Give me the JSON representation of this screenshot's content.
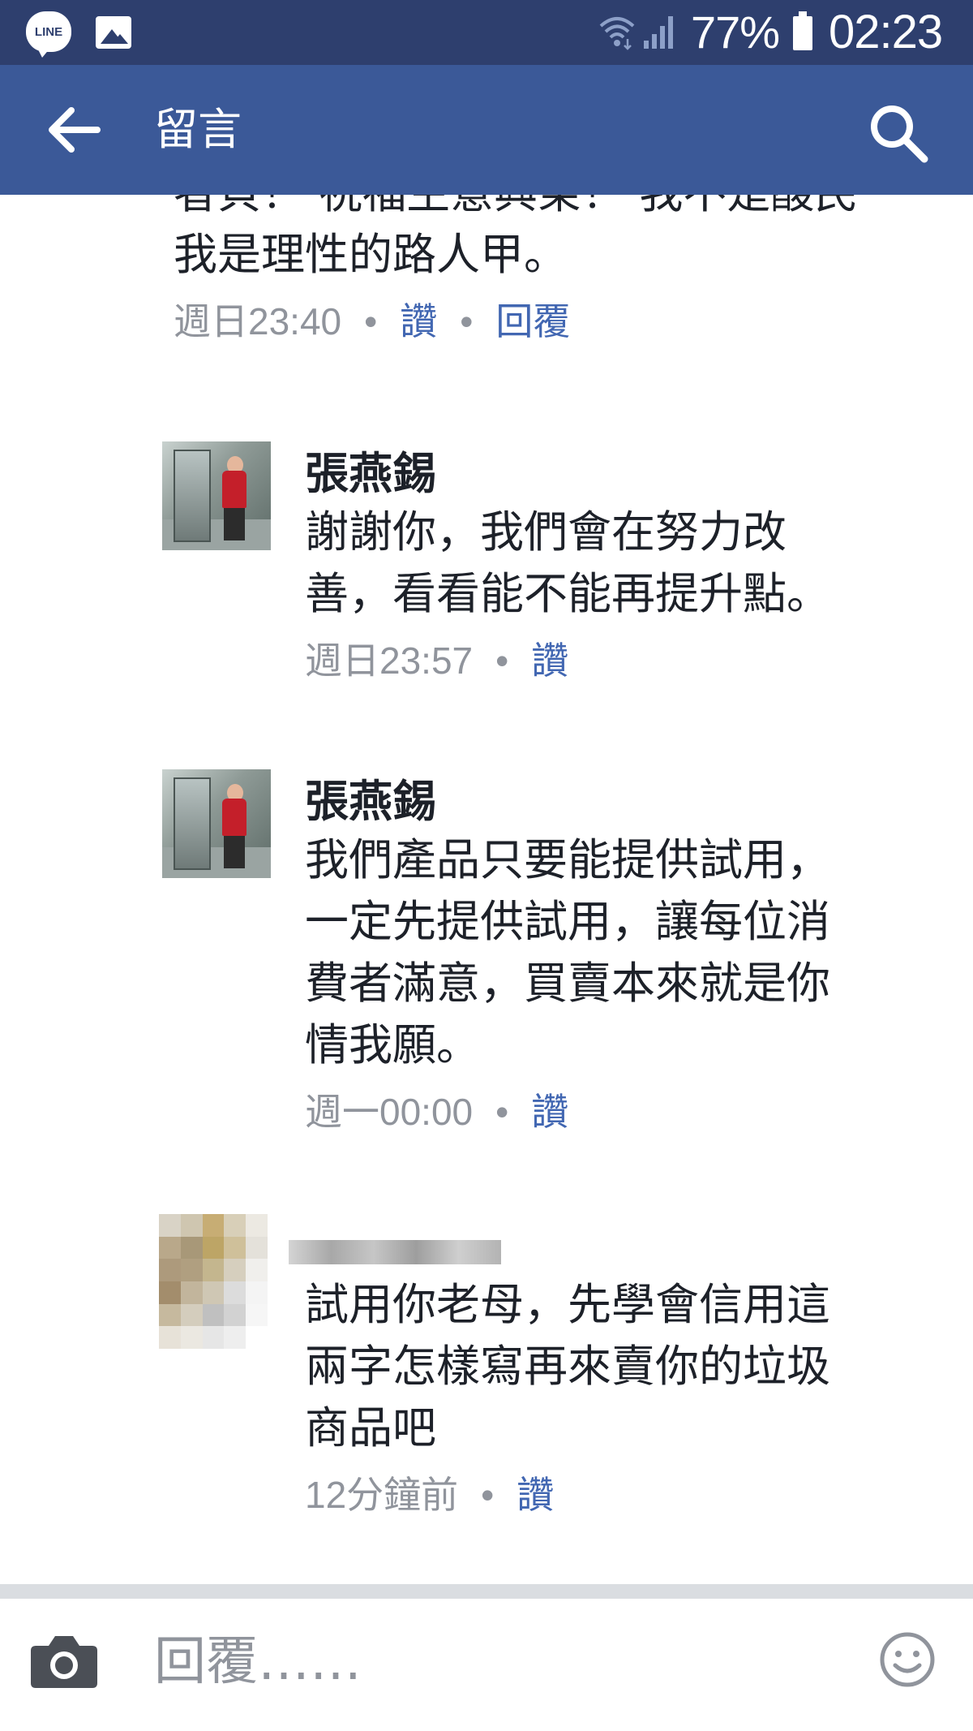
{
  "status_bar": {
    "line_label": "LINE",
    "battery": "77%",
    "time": "02:23",
    "icons": [
      "line-icon",
      "image-icon",
      "wifi-icon",
      "signal-icon",
      "battery-icon"
    ]
  },
  "app_bar": {
    "title": "留言",
    "icons": [
      "back-arrow-icon",
      "search-icon"
    ]
  },
  "comments": [
    {
      "text_lines": [
        "者貝！ 祝福生意興榮！ 我不是酸民",
        "我是理性的路人甲。"
      ],
      "time": "週日23:40",
      "like_label": "讚",
      "reply_label": "回覆"
    },
    {
      "author": "張燕錫",
      "text_lines": [
        "謝謝你，我們會在努力改",
        "善，看看能不能再提升點。"
      ],
      "time": "週日23:57",
      "like_label": "讚"
    },
    {
      "author": "張燕錫",
      "text_lines": [
        "我們產品只要能提供試用，",
        "一定先提供試用，讓每位消",
        "費者滿意，買賣本來就是你",
        "情我願。"
      ],
      "time": "週一00:00",
      "like_label": "讚"
    },
    {
      "text_lines": [
        "試用你老母，先學會信用這",
        "兩字怎樣寫再來賣你的垃圾",
        "商品吧"
      ],
      "time": "12分鐘前",
      "like_label": "讚"
    }
  ],
  "reply_bar": {
    "placeholder": "回覆……",
    "icons": [
      "camera-icon",
      "smiley-icon"
    ]
  },
  "colors": {
    "status_bar": "#2e3f6e",
    "app_bar": "#3b5998",
    "link": "#4267b2",
    "meta": "#90949c",
    "text": "#1d2129"
  }
}
